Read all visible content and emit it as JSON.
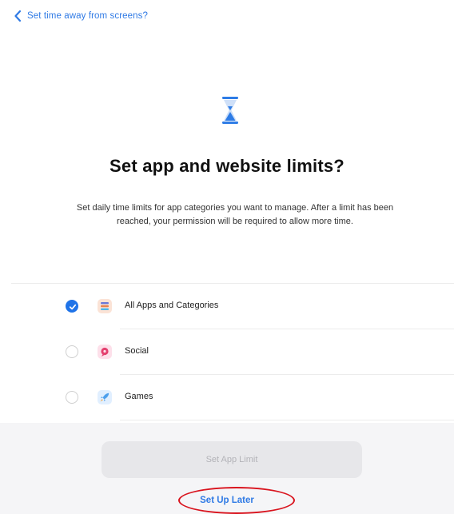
{
  "nav": {
    "back_label": "Set time away from screens?"
  },
  "hero": {
    "icon": "hourglass-icon",
    "title": "Set app and website limits?",
    "description": "Set daily time limits for app categories you want to manage. After a limit has been reached, your permission will be required to allow more time."
  },
  "options": [
    {
      "label": "All Apps and Categories",
      "selected": true,
      "icon": "all-apps-stack-icon"
    },
    {
      "label": "Social",
      "selected": false,
      "icon": "social-chat-icon"
    },
    {
      "label": "Games",
      "selected": false,
      "icon": "games-rocket-icon"
    }
  ],
  "footer": {
    "primary_button_label": "Set App Limit",
    "primary_button_enabled": false,
    "secondary_link_label": "Set Up Later"
  },
  "colors": {
    "accent": "#2f7ae5",
    "radio_selected": "#1f73e8",
    "annotation": "#d9141e"
  }
}
